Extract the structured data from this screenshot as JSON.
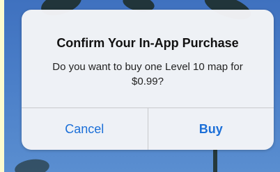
{
  "dialog": {
    "title": "Confirm Your In-App Purchase",
    "message": "Do you want to buy one Level 10 map for $0.99?",
    "cancel_label": "Cancel",
    "confirm_label": "Buy"
  },
  "colors": {
    "accent": "#1b6fd8",
    "dialog_bg": "#f4f5f7",
    "backdrop_sky": "#4a7ec8",
    "outer_bg": "#fdfbcf"
  }
}
